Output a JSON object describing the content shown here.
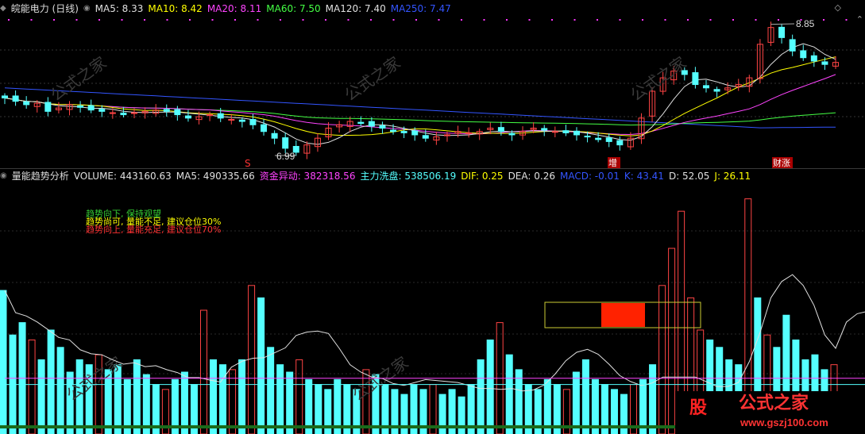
{
  "header_top": {
    "title": "皖能电力 (日线)",
    "ma": [
      {
        "label": "MA5: 8.33",
        "color": "#e0e0e0"
      },
      {
        "label": "MA10: 8.42",
        "color": "#ffff00"
      },
      {
        "label": "MA20: 8.11",
        "color": "#ff44ff"
      },
      {
        "label": "MA60: 7.50",
        "color": "#44ff44"
      },
      {
        "label": "MA120: 7.40",
        "color": "#e0e0e0"
      },
      {
        "label": "MA250: 7.47",
        "color": "#3355ff"
      }
    ]
  },
  "header_bottom": {
    "title": "量能趋势分析",
    "items": [
      {
        "label": "VOLUME: 443160.63",
        "color": "#e0e0e0"
      },
      {
        "label": "MA5: 490335.66",
        "color": "#e0e0e0"
      },
      {
        "label": "资金异动: 382318.56",
        "color": "#ff44ff"
      },
      {
        "label": "主力洗盘: 538506.19",
        "color": "#55ffff"
      },
      {
        "label": "DIF: 0.25",
        "color": "#ffff00"
      },
      {
        "label": "DEA: 0.26",
        "color": "#e0e0e0"
      },
      {
        "label": "MACD: -0.01",
        "color": "#3355ff"
      },
      {
        "label": "K: 43.41",
        "color": "#3355ff"
      },
      {
        "label": "D: 52.05",
        "color": "#e0e0e0"
      },
      {
        "label": "J: 26.11",
        "color": "#ffff00"
      }
    ]
  },
  "legend_notes": [
    {
      "text": "趋势向下, 保持观望",
      "color": "#33cc33"
    },
    {
      "text": "趋势尚可, 量能不足, 建议仓位30%",
      "color": "#ffff00"
    },
    {
      "text": "趋势向上, 量能充足, 建议仓位70%",
      "color": "#ff3333"
    }
  ],
  "annotations": {
    "high": "8.85",
    "low": "6.99",
    "marker_s": "S",
    "marker_zeng": "增",
    "marker_caizhang": "财涨"
  },
  "watermark": {
    "text": "公式之家",
    "url": "www.gszj100.com"
  },
  "chart_data": [
    {
      "type": "candlestick",
      "title": "皖能电力 (日线)",
      "annotations": {
        "high": 8.85,
        "low": 6.99
      },
      "close_series_approx": [
        7.8,
        7.75,
        7.7,
        7.72,
        7.6,
        7.65,
        7.7,
        7.66,
        7.62,
        7.6,
        7.58,
        7.55,
        7.58,
        7.6,
        7.62,
        7.6,
        7.55,
        7.5,
        7.52,
        7.55,
        7.5,
        7.48,
        7.45,
        7.4,
        7.3,
        7.2,
        7.05,
        6.99,
        7.1,
        7.2,
        7.35,
        7.4,
        7.45,
        7.42,
        7.38,
        7.35,
        7.3,
        7.28,
        7.25,
        7.2,
        7.22,
        7.25,
        7.3,
        7.28,
        7.3,
        7.35,
        7.3,
        7.25,
        7.3,
        7.35,
        7.32,
        7.3,
        7.28,
        7.25,
        7.22,
        7.18,
        7.15,
        7.1,
        7.2,
        7.5,
        7.9,
        8.1,
        8.2,
        8.15,
        8.0,
        7.95,
        7.9,
        7.95,
        8.0,
        8.1,
        8.6,
        8.85,
        8.7,
        8.5,
        8.4,
        8.35,
        8.3,
        8.33
      ]
    },
    {
      "type": "bar",
      "title": "量能趋势分析",
      "series": [
        {
          "name": "VOLUME",
          "values_approx": [
            0.58,
            0.4,
            0.45,
            0.38,
            0.3,
            0.42,
            0.35,
            0.25,
            0.3,
            0.28,
            0.32,
            0.26,
            0.28,
            0.22,
            0.3,
            0.24,
            0.2,
            0.18,
            0.22,
            0.25,
            0.2,
            0.5,
            0.3,
            0.28,
            0.26,
            0.3,
            0.6,
            0.55,
            0.35,
            0.28,
            0.25,
            0.3,
            0.22,
            0.2,
            0.18,
            0.22,
            0.2,
            0.18,
            0.26,
            0.24,
            0.2,
            0.18,
            0.16,
            0.2,
            0.18,
            0.2,
            0.16,
            0.18,
            0.15,
            0.2,
            0.3,
            0.38,
            0.45,
            0.32,
            0.26,
            0.2,
            0.18,
            0.22,
            0.2,
            0.18,
            0.25,
            0.3,
            0.22,
            0.2,
            0.18,
            0.16,
            0.2,
            0.22,
            0.28,
            0.6,
            0.75,
            0.9,
            0.55,
            0.42,
            0.38,
            0.35,
            0.3,
            0.28,
            0.95,
            0.55,
            0.4,
            0.35,
            0.48,
            0.38,
            0.3,
            0.32,
            0.26,
            0.28
          ]
        }
      ]
    }
  ]
}
